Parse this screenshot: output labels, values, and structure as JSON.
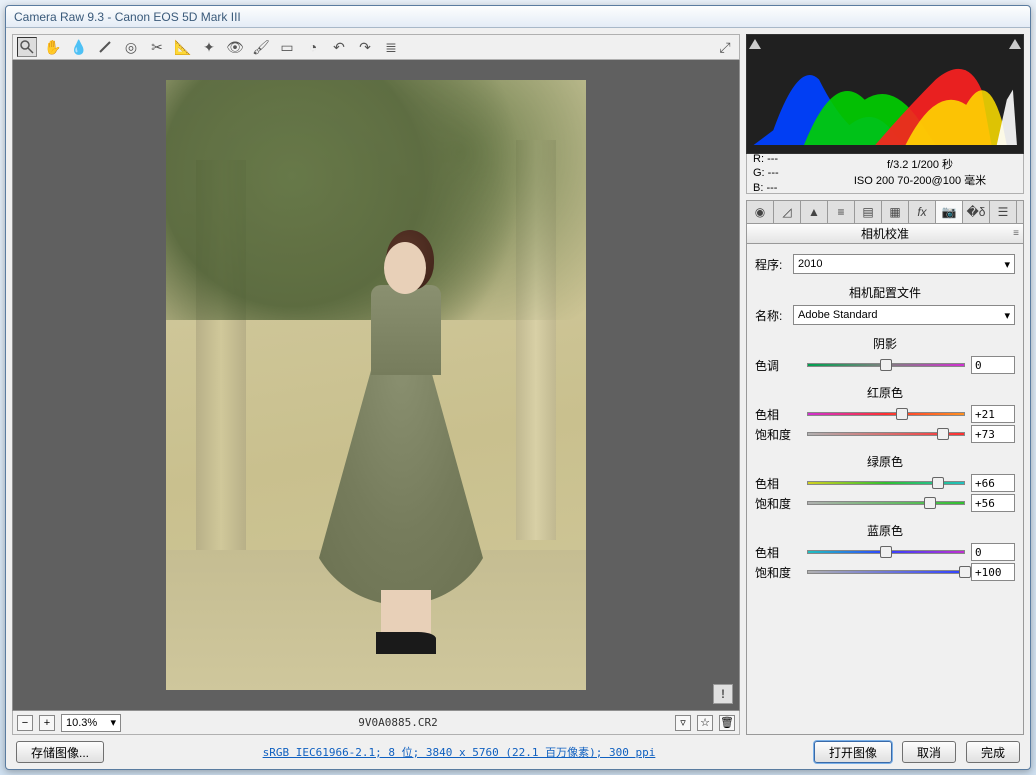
{
  "title": "Camera Raw 9.3  -  Canon EOS 5D Mark III",
  "toolbar_icons": [
    "zoom",
    "hand",
    "eyedropper-white",
    "eyedropper-color",
    "target",
    "crop",
    "straighten",
    "spot",
    "redeye",
    "brush",
    "gradient",
    "radial",
    "dust",
    "rotate-ccw",
    "rotate-cw",
    "preferences"
  ],
  "filename": "9V0A0885.CR2",
  "zoom": "10.3%",
  "histogram": {
    "rgb": {
      "r": "---",
      "g": "---",
      "b": "---"
    },
    "exposure": "f/3.2  1/200 秒",
    "iso_lens": "ISO 200  70-200@100 毫米"
  },
  "panel_title": "相机校准",
  "process": {
    "label": "程序:",
    "value": "2010"
  },
  "profile_section": "相机配置文件",
  "profile": {
    "label": "名称:",
    "value": "Adobe Standard"
  },
  "shadows": {
    "title": "阴影",
    "tint_label": "色调",
    "tint_value": "0"
  },
  "red": {
    "title": "红原色",
    "hue_label": "色相",
    "hue_value": "+21",
    "sat_label": "饱和度",
    "sat_value": "+73"
  },
  "green": {
    "title": "绿原色",
    "hue_label": "色相",
    "hue_value": "+66",
    "sat_label": "饱和度",
    "sat_value": "+56"
  },
  "blue": {
    "title": "蓝原色",
    "hue_label": "色相",
    "hue_value": "0",
    "sat_label": "饱和度",
    "sat_value": "+100"
  },
  "footer": {
    "save": "存储图像...",
    "link": "sRGB IEC61966-2.1; 8 位; 3840 x 5760 (22.1 百万像素); 300 ppi",
    "open": "打开图像",
    "cancel": "取消",
    "done": "完成"
  }
}
